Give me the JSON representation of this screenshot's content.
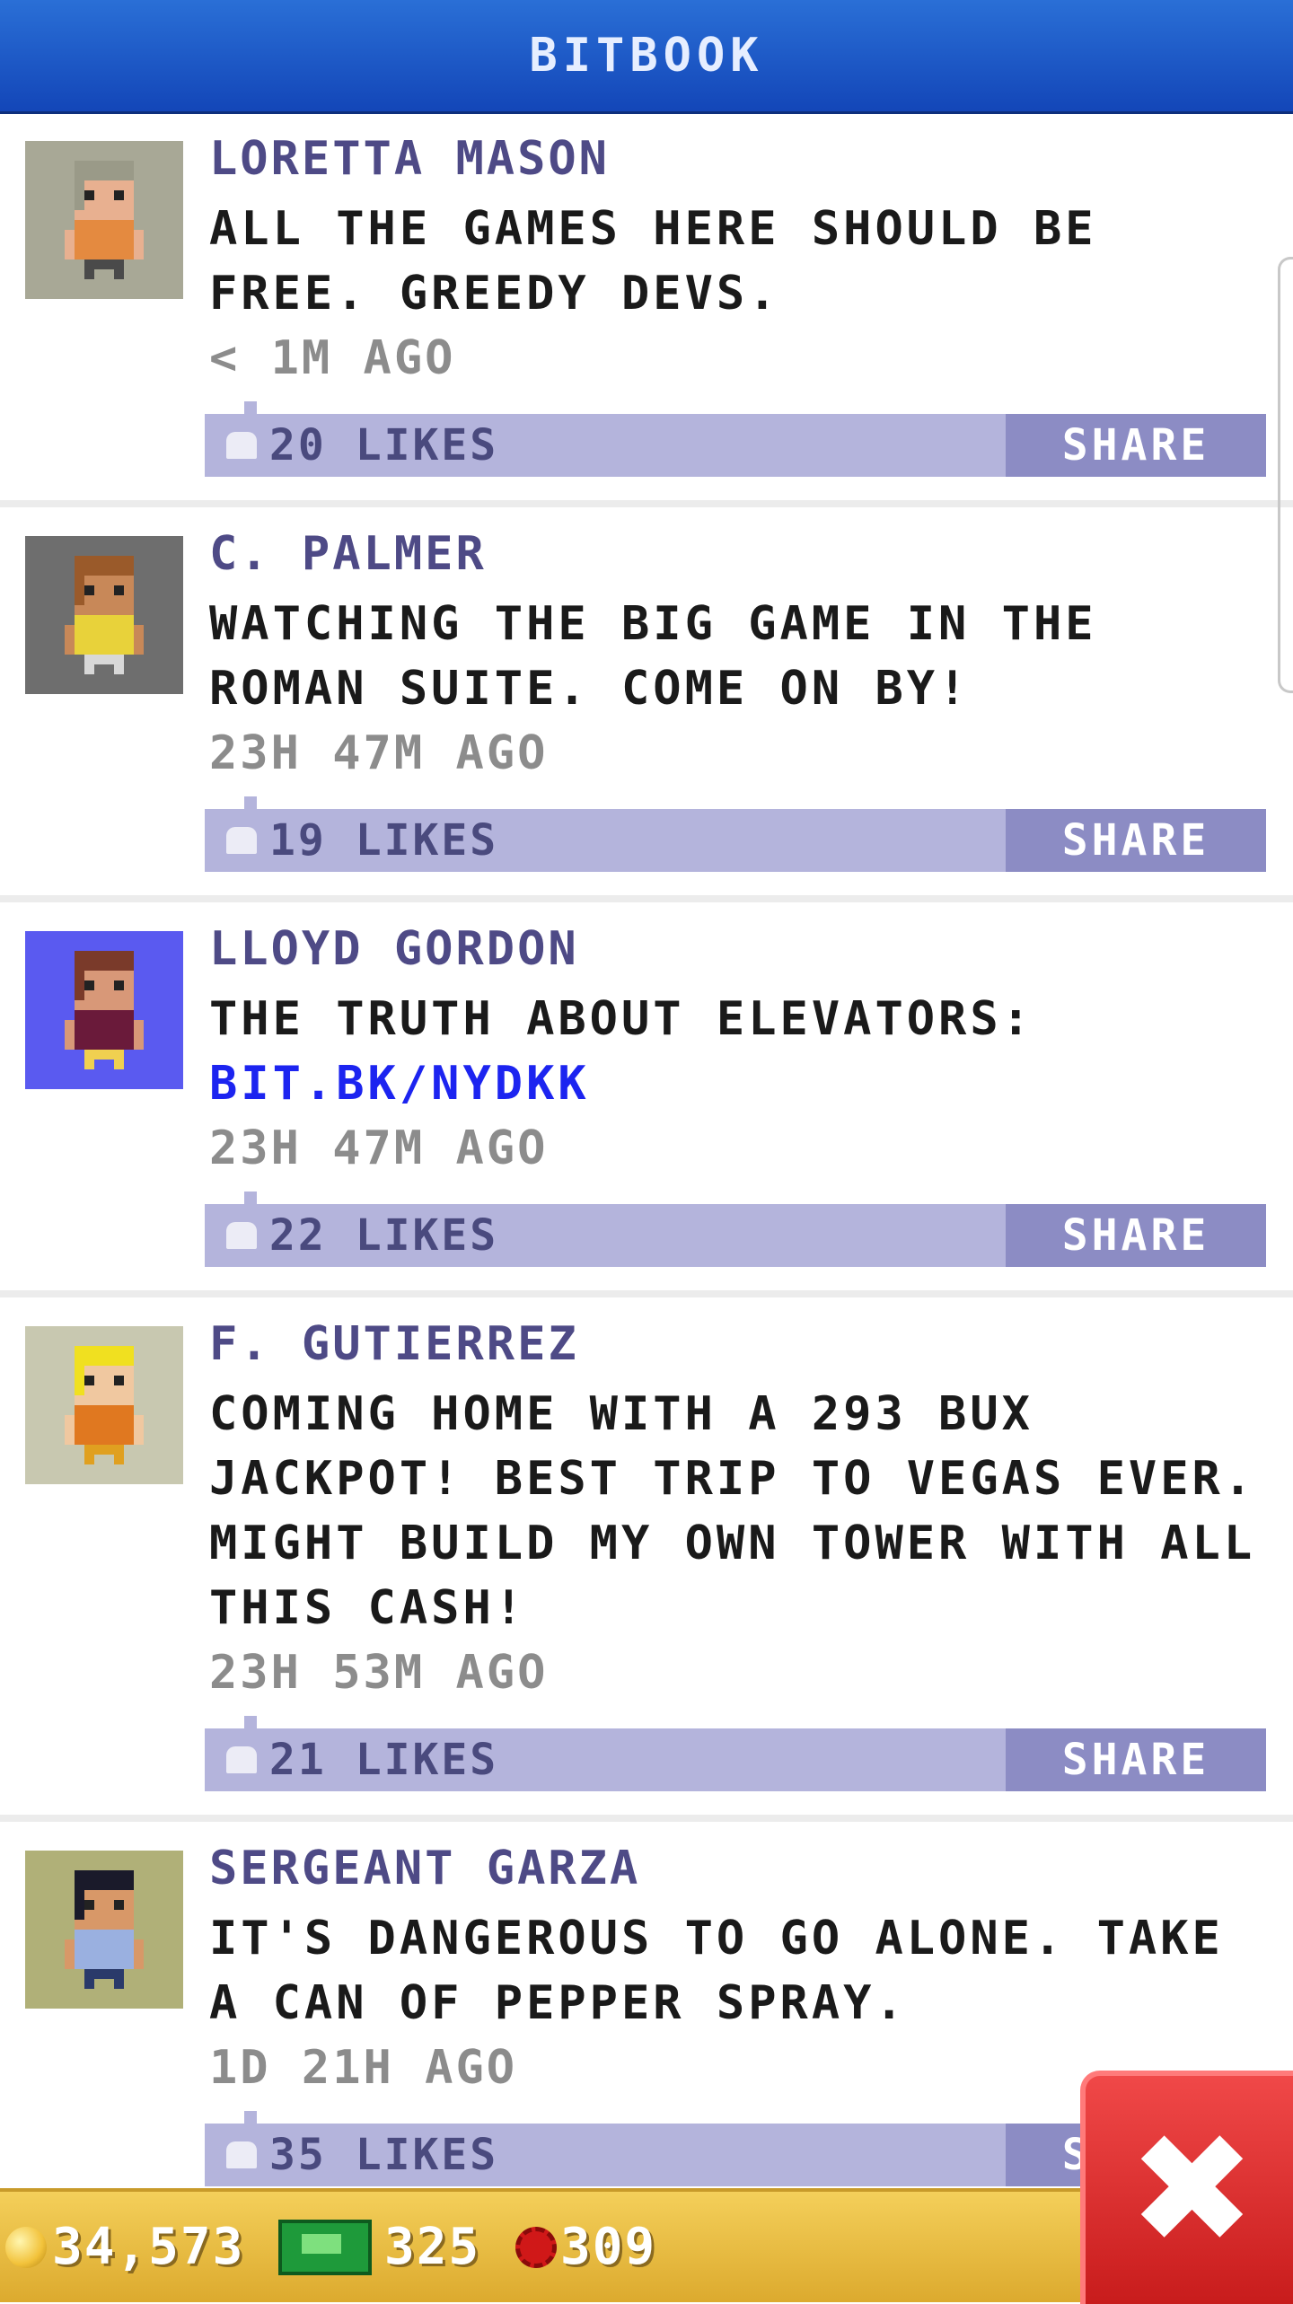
{
  "header": {
    "title": "BITBOOK"
  },
  "posts": [
    {
      "name": "LORETTA MASON",
      "message": "ALL THE GAMES HERE SHOULD BE FREE. GREEDY DEVS.",
      "link": "",
      "time": "< 1M AGO",
      "likes": "20 LIKES",
      "share": "SHARE",
      "avatar": {
        "bg": "#a8a896",
        "hair": "#9a9a88",
        "skin": "#e8b090",
        "shirt": "#e48a40",
        "pants": "#4a4a4a"
      }
    },
    {
      "name": "C. PALMER",
      "message": "WATCHING THE BIG GAME IN THE ROMAN SUITE. COME ON BY!",
      "link": "",
      "time": "23H 47M AGO",
      "likes": "19 LIKES",
      "share": "SHARE",
      "avatar": {
        "bg": "#6e6e6e",
        "hair": "#9a5a2a",
        "skin": "#c88858",
        "shirt": "#e8d23a",
        "pants": "#d8d8d8"
      }
    },
    {
      "name": "LLOYD GORDON",
      "message": "THE TRUTH ABOUT ELEVATORS:",
      "link": "BIT.BK/NYDKK",
      "time": "23H 47M AGO",
      "likes": "22 LIKES",
      "share": "SHARE",
      "avatar": {
        "bg": "#5a5af0",
        "hair": "#7a3a2a",
        "skin": "#d89878",
        "shirt": "#6a1a3a",
        "pants": "#f0d050"
      }
    },
    {
      "name": "F. GUTIERREZ",
      "message": "COMING HOME WITH A 293 BUX JACKPOT! BEST TRIP TO VEGAS EVER. MIGHT BUILD MY OWN TOWER WITH ALL THIS CASH!",
      "link": "",
      "time": "23H 53M AGO",
      "likes": "21 LIKES",
      "share": "SHARE",
      "avatar": {
        "bg": "#c8c8b0",
        "hair": "#f0e020",
        "skin": "#f0c8a0",
        "shirt": "#e07820",
        "pants": "#e0a020"
      }
    },
    {
      "name": "SERGEANT GARZA",
      "message": "IT'S DANGEROUS TO GO ALONE. TAKE A CAN OF PEPPER SPRAY.",
      "link": "",
      "time": "1D 21H AGO",
      "likes": "35 LIKES",
      "share": "SHARE",
      "avatar": {
        "bg": "#b0b078",
        "hair": "#1a1a2a",
        "skin": "#d89868",
        "shirt": "#9ab0e0",
        "pants": "#2a3a6a"
      }
    }
  ],
  "resources": {
    "coins": "34,573",
    "bux": "325",
    "gems": "309"
  },
  "close_label": "✖"
}
